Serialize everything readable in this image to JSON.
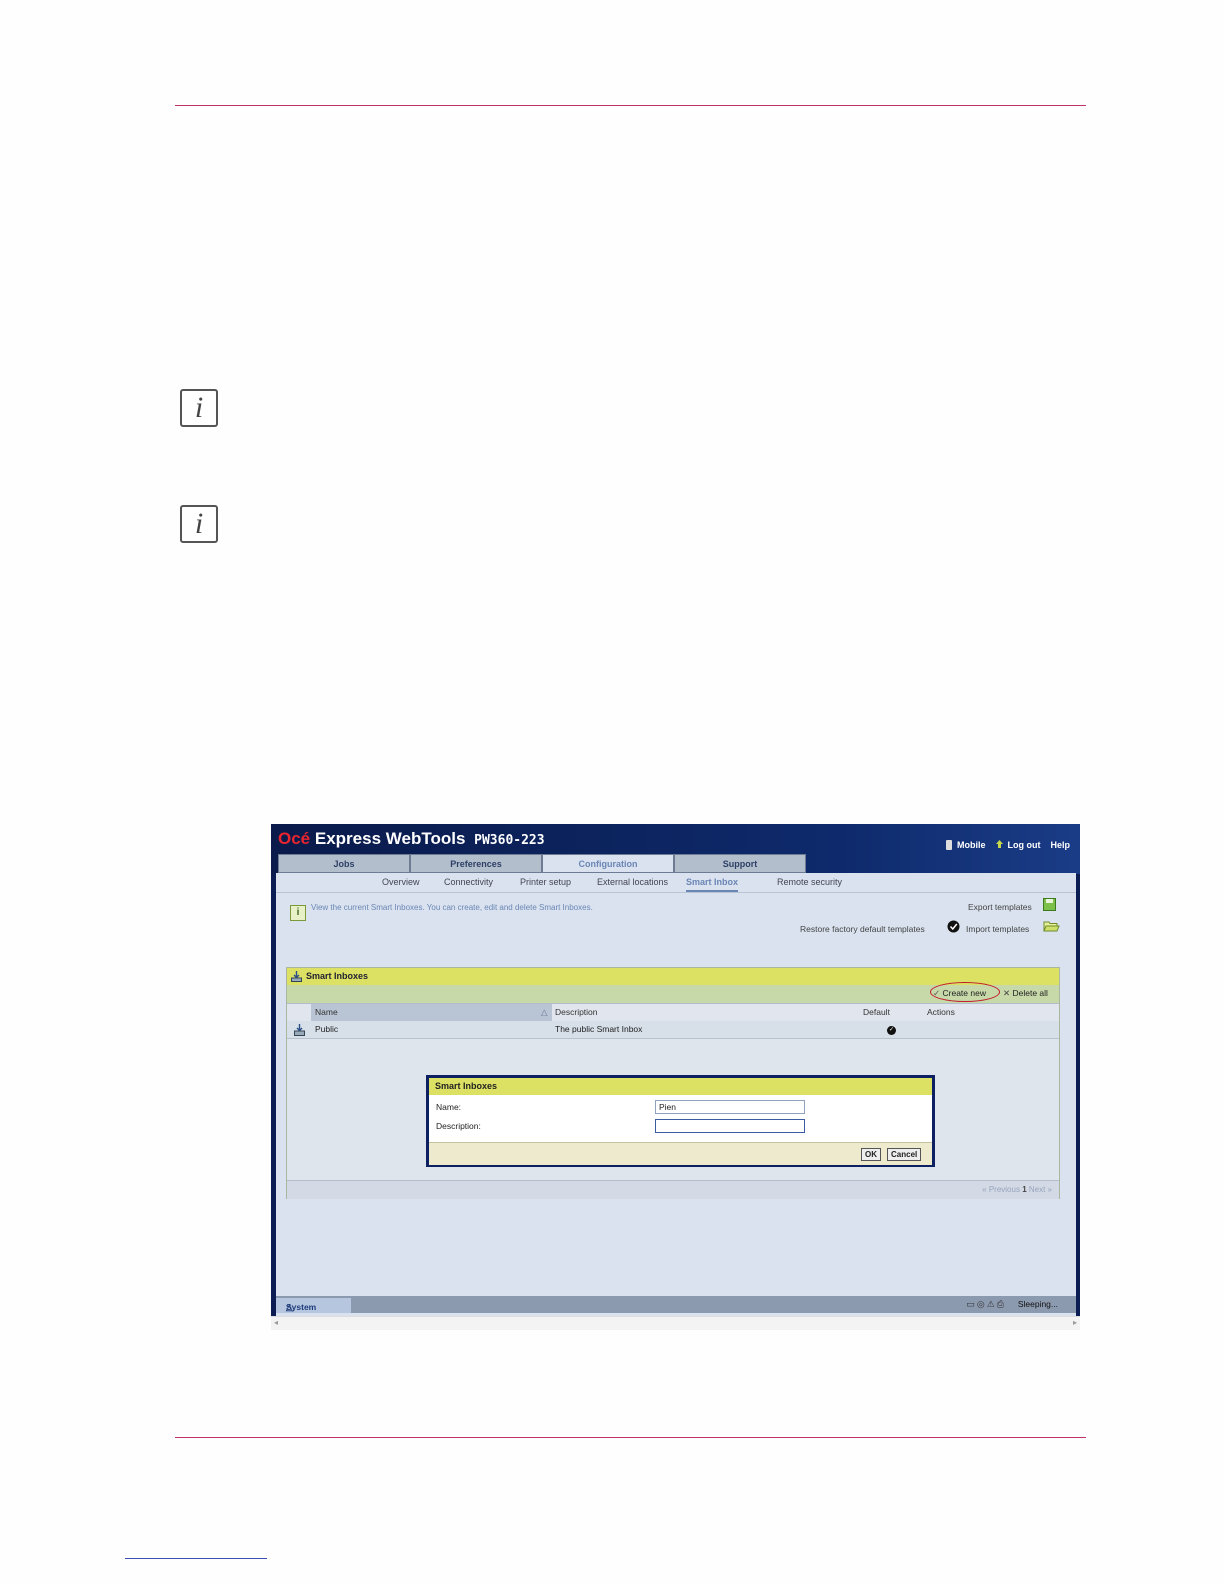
{
  "app": {
    "brand": "Océ",
    "title": "Express WebTools",
    "model": "PW360-223",
    "links": [
      "Mobile",
      "Log out",
      "Help"
    ]
  },
  "tabs": [
    "Jobs",
    "Preferences",
    "Configuration",
    "Support"
  ],
  "subnav": [
    "Overview",
    "Connectivity",
    "Printer setup",
    "External locations",
    "Smart Inbox",
    "Remote security"
  ],
  "info_text": "View the current Smart Inboxes. You can create, edit and delete Smart Inboxes.",
  "actions": {
    "export": "Export templates",
    "restore": "Restore factory default templates",
    "import": "Import templates"
  },
  "panel": {
    "title": "Smart Inboxes",
    "create_new": "Create new",
    "delete_all": "Delete all",
    "columns": [
      "Name",
      "Description",
      "Default",
      "Actions"
    ],
    "rows": [
      {
        "name": "Public",
        "description": "The public Smart Inbox"
      }
    ],
    "pager": {
      "previous": "« Previous",
      "page": "1",
      "next": "Next »"
    }
  },
  "dialog": {
    "title": "Smart Inboxes",
    "name_label": "Name:",
    "name_value": "Pien",
    "description_label": "Description:",
    "description_value": "",
    "ok": "OK",
    "cancel": "Cancel"
  },
  "status": {
    "system": "System",
    "state": "Sleeping..."
  },
  "colors": {
    "rule": "#c0336a",
    "header": "#0a1a4a",
    "brand_red": "#e8252f",
    "panel_header": "#dce063",
    "highlight_circle": "#c0182a"
  }
}
